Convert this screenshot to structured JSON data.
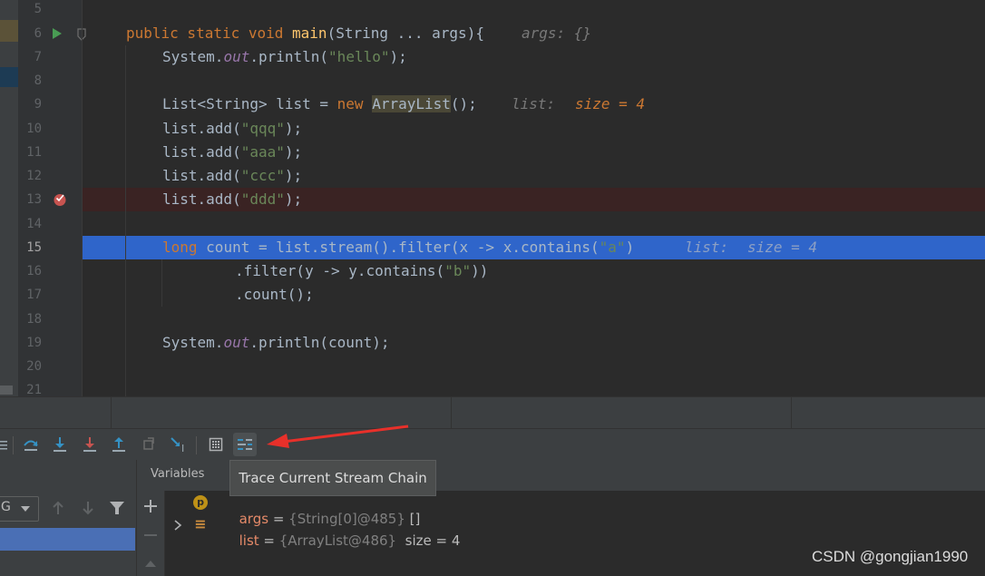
{
  "editor": {
    "line_numbers": [
      "5",
      "6",
      "7",
      "8",
      "9",
      "10",
      "11",
      "12",
      "13",
      "14",
      "15",
      "16",
      "17",
      "18",
      "19",
      "20",
      "21"
    ],
    "current_line": "15",
    "code": {
      "l6": {
        "kw1": "public static void ",
        "fn": "main",
        "rest": "(String ... args){",
        "hint": "args: {}"
      },
      "l7": {
        "a": "System.",
        "it": "out",
        "b": ".println(",
        "s": "\"hello\"",
        "c": ");"
      },
      "l9": {
        "a": "List<String> list = ",
        "kw": "new ",
        "cls": "ArrayList",
        "b": "();",
        "hint": "list:",
        "hintv": "size = 4"
      },
      "l10": {
        "a": "list.add(",
        "s": "\"qqq\"",
        "b": ");"
      },
      "l11": {
        "a": "list.add(",
        "s": "\"aaa\"",
        "b": ");"
      },
      "l12": {
        "a": "list.add(",
        "s": "\"ccc\"",
        "b": ");"
      },
      "l13": {
        "a": "list.add(",
        "s": "\"ddd\"",
        "b": ");"
      },
      "l15": {
        "kw": "long ",
        "a": "count = list.stream().filter(x -> x.contains(",
        "s": "\"a\"",
        "b": ")",
        "hint": "list:",
        "hintv": "size = 4"
      },
      "l16": {
        "a": ".filter(y -> y.contains(",
        "s": "\"b\"",
        "b": "))"
      },
      "l17": {
        "a": ".count();"
      },
      "l19": {
        "a": "System.",
        "it": "out",
        "b": ".println(count);"
      }
    }
  },
  "debugger": {
    "tooltip": "Trace Current Stream Chain",
    "variables_tab": "Variables",
    "frames_dropdown": "G",
    "vars": [
      {
        "badge": "p",
        "name": "args",
        "eq": " = ",
        "value": "{String[0]@485}",
        "extra": " []"
      },
      {
        "badge": "≡",
        "name": "list",
        "eq": " = ",
        "value": "{ArrayList@486}",
        "extra": "  size = 4"
      }
    ]
  },
  "watermark": "CSDN @gongjian1990",
  "colors": {
    "accent": "#2f65ca",
    "breakpoint": "#c75450",
    "arrow": "#e8302a"
  }
}
